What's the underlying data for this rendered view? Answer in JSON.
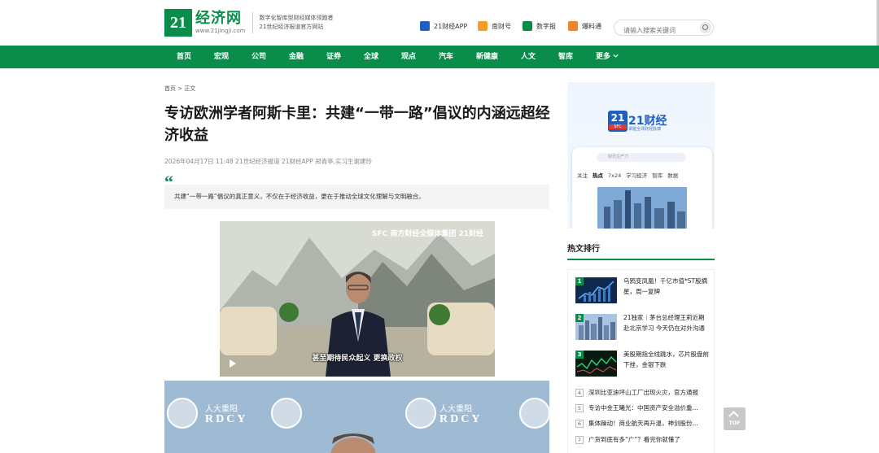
{
  "header": {
    "logo_num": "21",
    "logo_cn": "经济网",
    "logo_url": "www.21jingji.com",
    "slogan_1": "数字化智库型财经媒体领跑者",
    "slogan_2": "21世纪经济报道官方网站",
    "tools": [
      {
        "label": "21财经APP",
        "icon": "app-icon",
        "color": "#1f5fbf"
      },
      {
        "label": "南财号",
        "icon": "nancaihao-icon",
        "color": "#f29b26"
      },
      {
        "label": "数字报",
        "icon": "digital-paper-icon",
        "color": "#0a8d4b"
      },
      {
        "label": "爆料通",
        "icon": "tipoff-icon",
        "color": "#f2852a"
      }
    ],
    "search_placeholder": "请输入搜索关键词"
  },
  "nav": [
    "首页",
    "宏观",
    "公司",
    "金融",
    "证券",
    "全球",
    "观点",
    "汽车",
    "新健康",
    "人文",
    "智库",
    "更多"
  ],
  "nav_more_icon": "chevron-down-icon",
  "breadcrumb": "首页 > 正文",
  "article": {
    "title": "专访欧洲学者阿斯卡里：共建“一带一路”倡议的内涵远超经济收益",
    "meta": "2026年04月17日 11:48   21世纪经济报道 21财经APP   郑青亭,实习生谢建玲",
    "quote_mark": "“",
    "summary": "共建“一带一路”倡议的真正意义，不仅在于经济收益，更在于推动全球文化理解与文明融合。",
    "video_logo": "SFC 南方财经全媒体集团 21财经",
    "video_caption": "甚至期待民众起义 更换政权",
    "photo_text_cn": "人大重阳",
    "photo_text_en": "RDCY"
  },
  "ad": {
    "brand_num": "21",
    "brand_badge": "SFC",
    "brand_title": "21财经",
    "brand_sub": "掌握全球财经脉搏",
    "search_hint": "财讯生产力",
    "tabs": [
      "关注",
      "热点",
      "7x24",
      "学习经济",
      "智库",
      "数据"
    ]
  },
  "hot": {
    "heading": "热文排行",
    "top_items": [
      {
        "rank": "1",
        "text": "乌鸦变凤凰！千亿市值*ST股摘星，周一复牌"
      },
      {
        "rank": "2",
        "text": "21独家｜茅台总经理王莉近期赴北京学习 今天仍在对外沟通"
      },
      {
        "rank": "3",
        "text": "美股期指全线跳水，芯片股盘前下挫，金银下跌"
      }
    ],
    "list": [
      {
        "rank": "4",
        "text": "深圳比亚迪坪山工厂出现火灾，官方通报"
      },
      {
        "rank": "5",
        "text": "专访中金王曦光：中国资产安全溢价重..."
      },
      {
        "rank": "6",
        "text": "集体躁动！商业航天再升温，神剑股份..."
      },
      {
        "rank": "7",
        "text": "广货到底有多“广”？看完你就懂了"
      }
    ]
  },
  "back_to_top": "TOP"
}
